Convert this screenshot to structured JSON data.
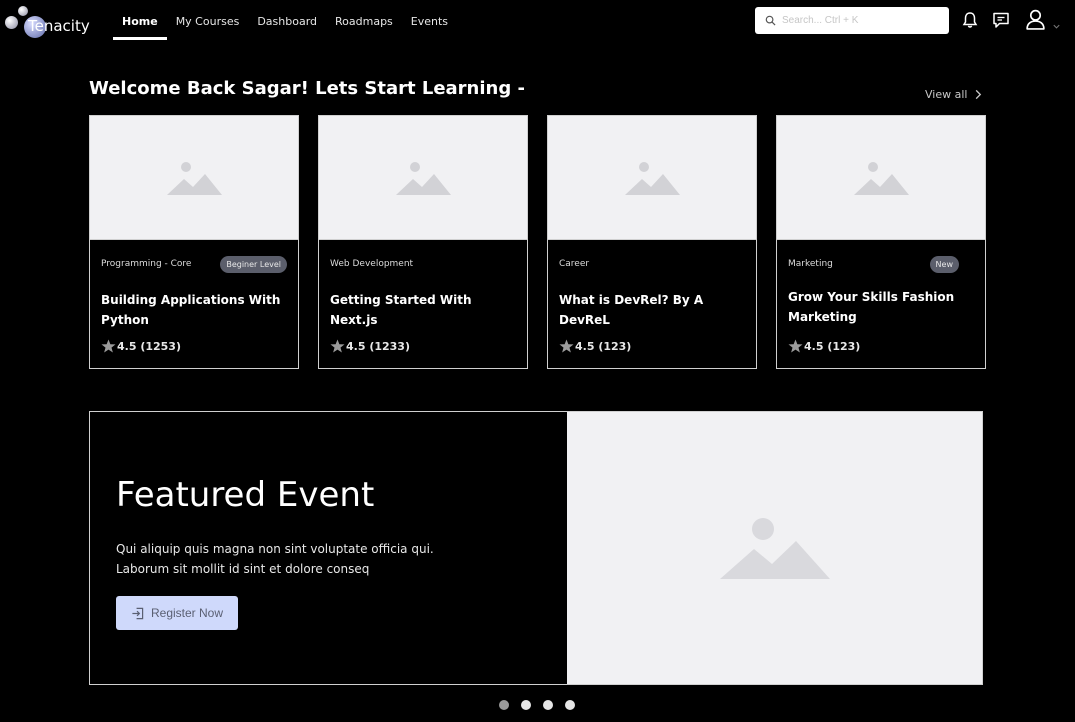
{
  "brand": {
    "name": "Tenacity"
  },
  "nav": {
    "links": [
      {
        "label": "Home",
        "active": true
      },
      {
        "label": "My Courses",
        "active": false
      },
      {
        "label": "Dashboard",
        "active": false
      },
      {
        "label": "Roadmaps",
        "active": false
      },
      {
        "label": "Events",
        "active": false
      }
    ],
    "search_placeholder": "Search... Ctrl + K",
    "icons": [
      "bell-icon",
      "chat-icon",
      "user-icon",
      "chevron-down-icon"
    ]
  },
  "welcome": {
    "heading": "Welcome Back Sagar! Lets Start Learning -",
    "view_all": "View all"
  },
  "courses": [
    {
      "category": "Programming - Core",
      "badge": "Beginer Level",
      "title": "Building Applications With Python",
      "rating": "4.5 (1253)"
    },
    {
      "category": "Web Development",
      "badge": "",
      "title": "Getting Started With Next.js",
      "rating": "4.5 (1233)"
    },
    {
      "category": "Career",
      "badge": "",
      "title": "What is DevRel? By A DevReL",
      "rating": "4.5 (123)"
    },
    {
      "category": "Marketing",
      "badge": "New",
      "title": "Grow Your Skills Fashion Marketing",
      "rating": "4.5 (123)"
    }
  ],
  "featured": {
    "title": "Featured Event",
    "description": "Qui aliquip quis magna non sint voluptate officia qui. Laborum sit mollit id sint et dolore conseq",
    "button": "Register Now"
  },
  "carousel": {
    "count": 4,
    "active_index": 0
  },
  "colors": {
    "background": "#000000",
    "placeholder_bg": "#f1f1f3",
    "badge_bg": "#5b5e6b",
    "button_bg": "#cfd9fb"
  }
}
